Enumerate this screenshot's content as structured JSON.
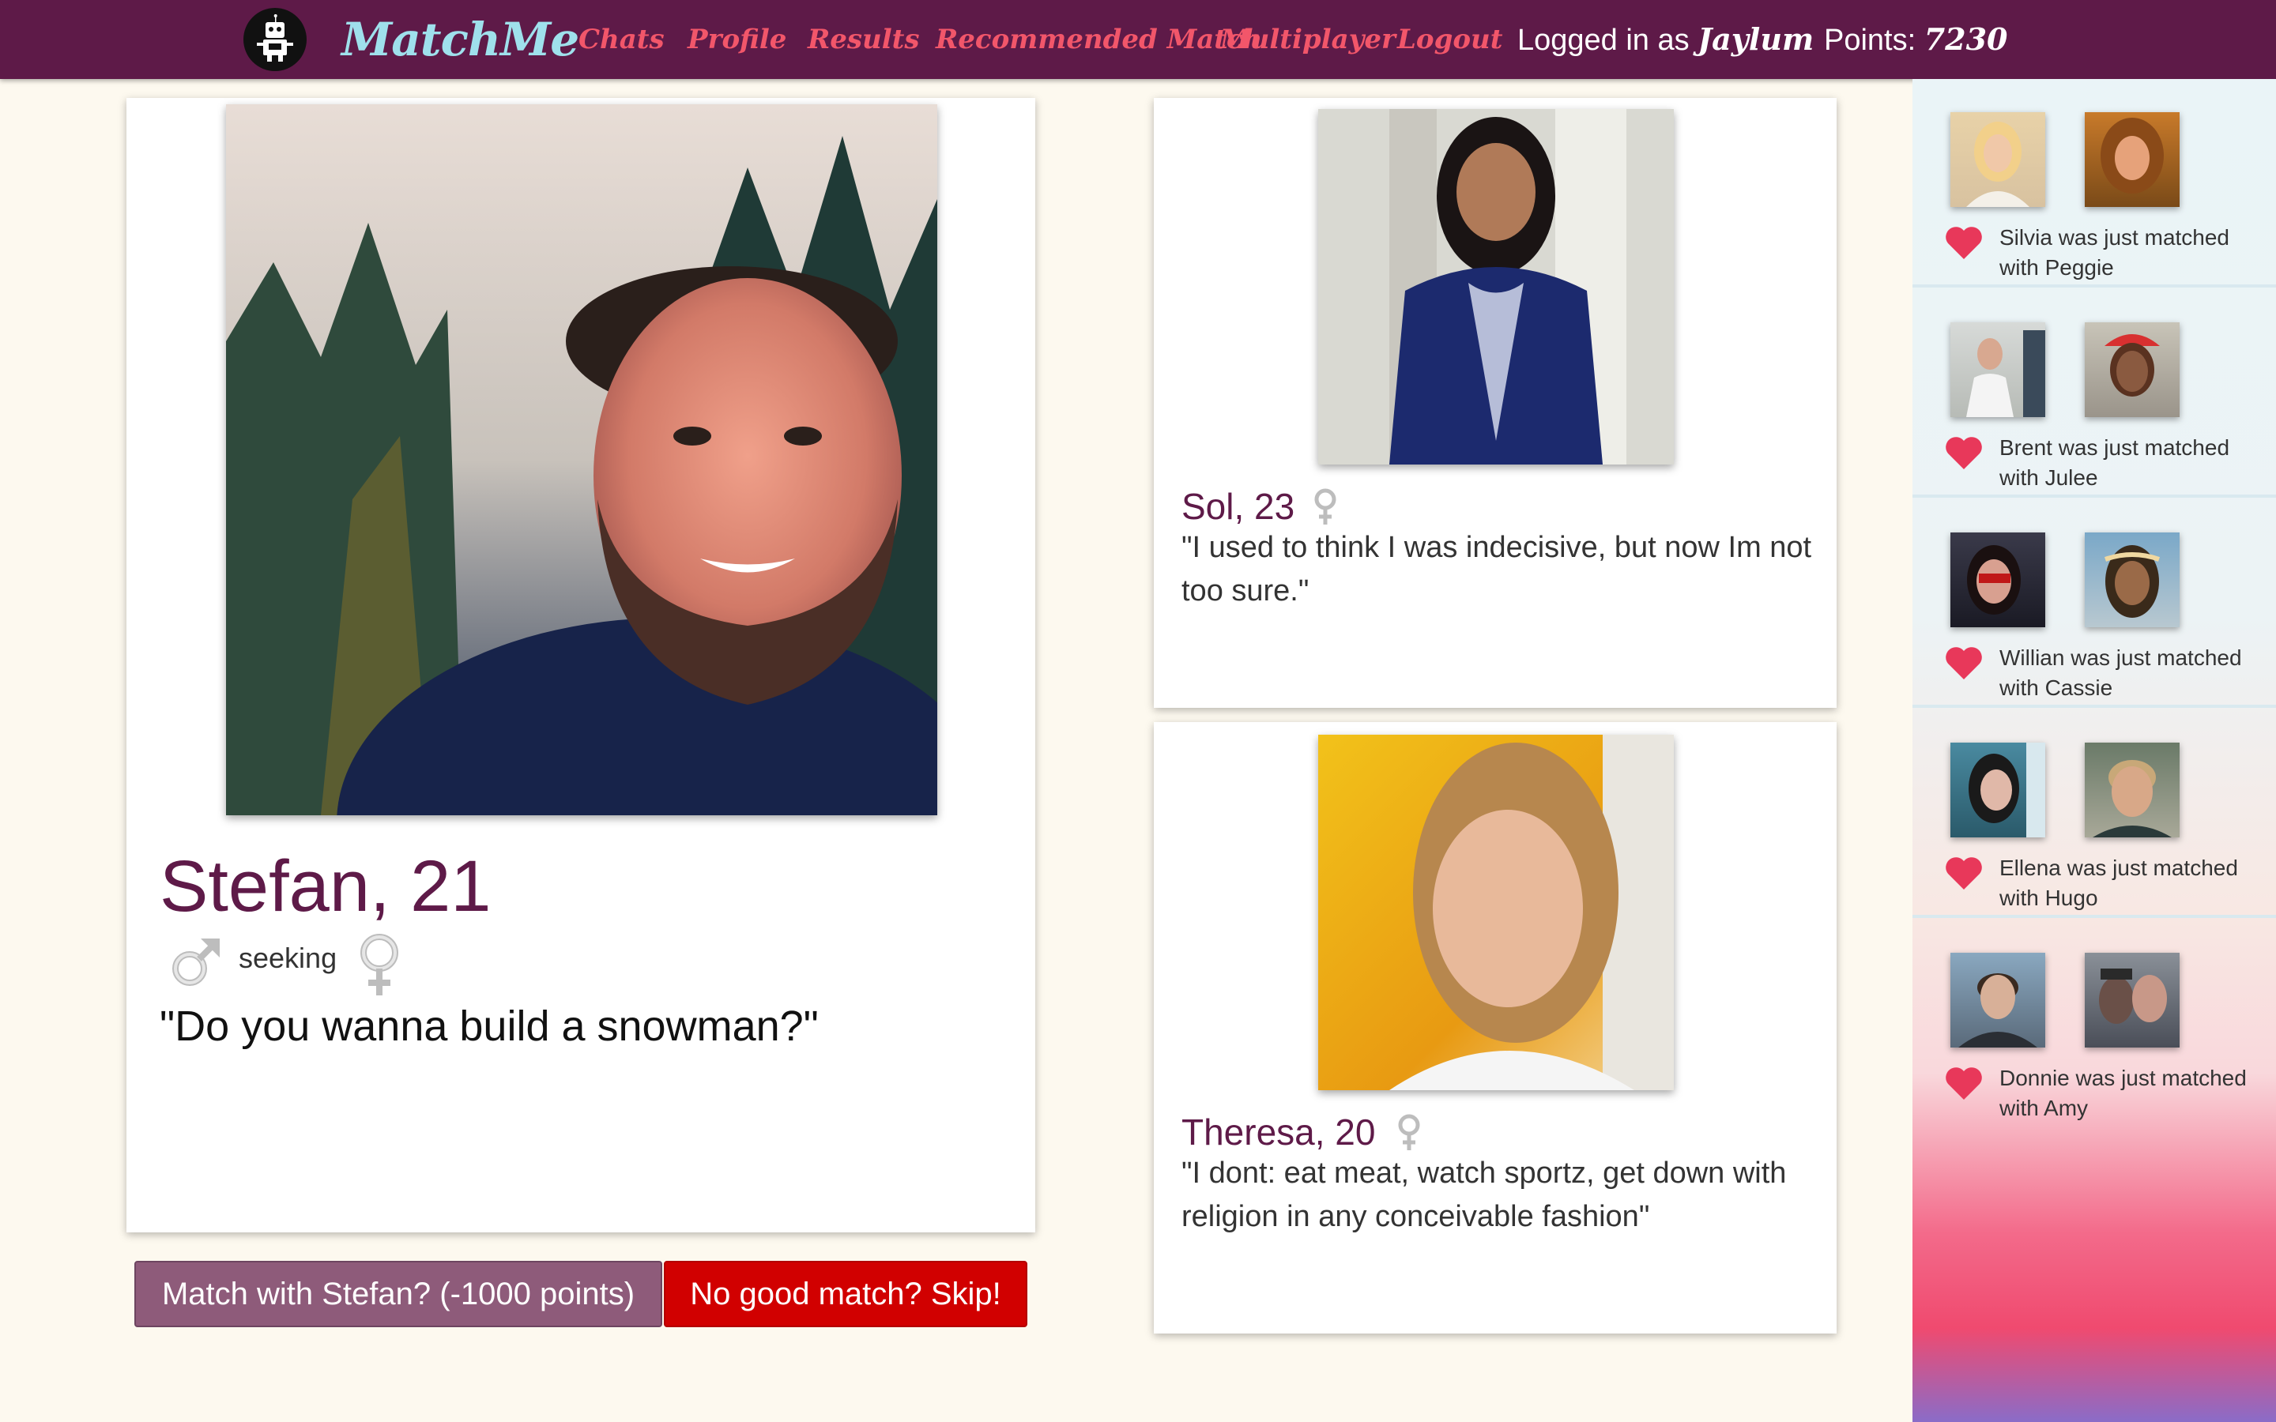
{
  "nav": {
    "brand": "MatchMe",
    "links": [
      "Chats",
      "Profile",
      "Results",
      "Recommended Match",
      "Multiplayer",
      "Logout"
    ],
    "logged_in_prefix": "Logged in as",
    "username": "Jaylum",
    "points_label": "Points:",
    "points_value": "7230"
  },
  "main": {
    "name_age": "Stefan, 21",
    "seeking_label": "seeking",
    "own_gender_icon": "male-symbol-icon",
    "seeking_gender_icon": "female-symbol-icon",
    "quote": "\"Do you wanna build a snowman?\"",
    "match_button": "Match with Stefan? (-1000 points)",
    "skip_button": "No good match? Skip!"
  },
  "recommendations": [
    {
      "name_age": "Sol, 23",
      "gender_icon": "female-symbol-icon",
      "quote": "\"I used to think I was indecisive, but now Im not too sure.\""
    },
    {
      "name_age": "Theresa, 20",
      "gender_icon": "female-symbol-icon",
      "quote": "\"I dont: eat meat, watch sportz, get down with religion in any conceivable fashion\""
    }
  ],
  "feed": [
    {
      "text": "Silvia was just matched with Peggie"
    },
    {
      "text": "Brent was just matched with Julee"
    },
    {
      "text": "Willian was just matched with Cassie"
    },
    {
      "text": "Ellena was just matched with Hugo"
    },
    {
      "text": "Donnie was just matched with Amy"
    }
  ],
  "colors": {
    "nav_bg": "#5e1a48",
    "brand": "#9fe0ec",
    "nav_link": "#f2566a",
    "name": "#5e1a48",
    "match_button": "#8e5b7a",
    "skip_button": "#d10000",
    "heart": "#e8385a"
  }
}
